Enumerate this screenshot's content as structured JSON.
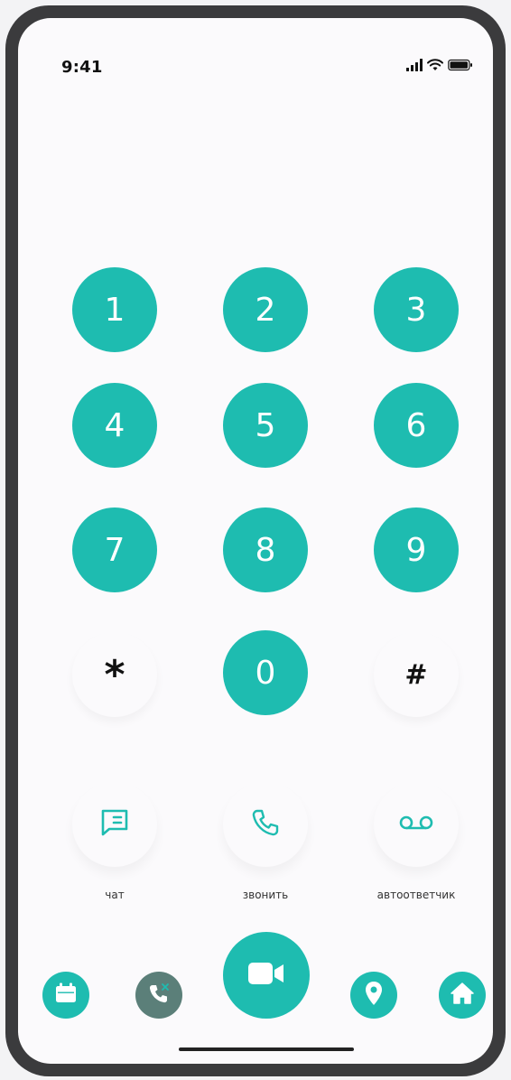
{
  "status_bar": {
    "time": "9:41",
    "icons": [
      "signal-icon",
      "wifi-icon",
      "battery-icon"
    ]
  },
  "keypad": {
    "keys": [
      "1",
      "2",
      "3",
      "4",
      "5",
      "6",
      "7",
      "8",
      "9",
      "*",
      "0",
      "#"
    ]
  },
  "actions": {
    "chat_label": "чат",
    "call_label": "звонить",
    "voicemail_label": "автоответчик"
  },
  "bottom_nav": {
    "items": [
      "calendar-icon",
      "phone-icon",
      "video-camera-icon",
      "location-pin-icon",
      "home-icon"
    ]
  },
  "colors": {
    "accent": "#1ebcb0",
    "background": "#fbfafc",
    "phone_nav_bg": "#5b7f79",
    "frame": "#3b3b3d"
  }
}
